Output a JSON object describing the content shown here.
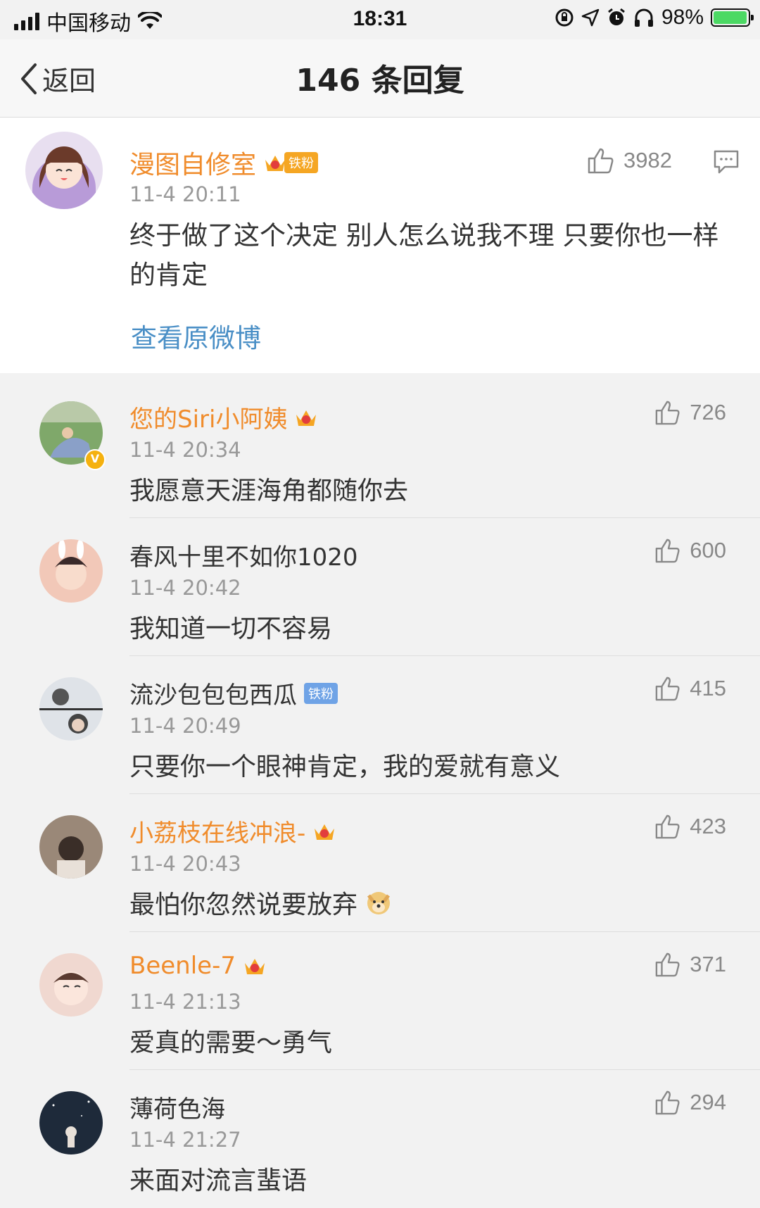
{
  "status_bar": {
    "carrier": "中国移动",
    "time": "18:31",
    "battery_pct": "98%",
    "battery_level": 0.98
  },
  "nav": {
    "back_label": "返回",
    "title": "146 条回复"
  },
  "main_post": {
    "username": "漫图自修室",
    "fan_badge": "铁粉",
    "time": "11-4 20:11",
    "text": "终于做了这个决定 别人怎么说我不理 只要你也一样的肯定",
    "likes": "3982",
    "view_original": "查看原微博"
  },
  "replies": [
    {
      "username": "您的Siri小阿姨",
      "name_color": "orange",
      "time": "11-4 20:34",
      "text": "我愿意天涯海角都随你去",
      "likes": "726",
      "crown": true,
      "verified": true
    },
    {
      "username": "春风十里不如你1020",
      "name_color": "dark",
      "time": "11-4 20:42",
      "text": "我知道一切不容易",
      "likes": "600"
    },
    {
      "username": "流沙包包包西瓜",
      "name_color": "dark",
      "time": "11-4 20:49",
      "text": "只要你一个眼神肯定，我的爱就有意义",
      "likes": "415",
      "fan_badge": "铁粉"
    },
    {
      "username": "小荔枝在线冲浪-",
      "name_color": "orange",
      "time": "11-4 20:43",
      "text": "最怕你忽然说要放弃",
      "likes": "423",
      "crown": true,
      "emoji": "doge-emoji"
    },
    {
      "username": "Beenle-7",
      "name_color": "orange",
      "time": "11-4 21:13",
      "text": "爱真的需要～勇气",
      "likes": "371",
      "crown": true
    },
    {
      "username": "薄荷色海",
      "name_color": "dark",
      "time": "11-4 21:27",
      "text": "来面对流言蜚语",
      "likes": "294"
    }
  ],
  "colors": {
    "accent_orange": "#f08c2c",
    "link_blue": "#4a8fc6",
    "battery_green": "#4cd964"
  }
}
